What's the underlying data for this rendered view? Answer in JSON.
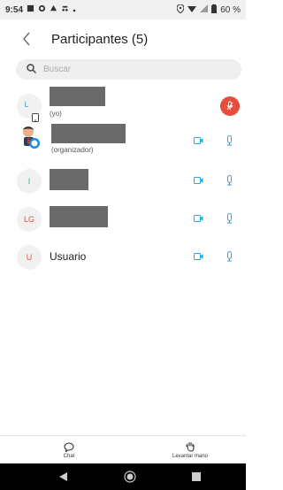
{
  "status_bar": {
    "time": "9:54",
    "battery": "60 %"
  },
  "header": {
    "title": "Participantes (5)",
    "back_icon": "chevron-left-icon"
  },
  "search": {
    "placeholder": "Buscar"
  },
  "participants": [
    {
      "initials": "L",
      "name": "[redacted]",
      "subtitle": "(yo)"
    },
    {
      "initials": "",
      "name": "[redacted]",
      "subtitle": "(organizador)"
    },
    {
      "initials": "I",
      "name": "[redacted]",
      "subtitle": ""
    },
    {
      "initials": "LG",
      "name": "[redacted]",
      "subtitle": ""
    },
    {
      "initials": "U",
      "name": "Usuario",
      "subtitle": ""
    }
  ],
  "colors": {
    "accent": "#29a8e0",
    "danger": "#e74c3c"
  },
  "bottom_tabs": [
    {
      "label": "Chat",
      "icon": "chat-bubble-icon"
    },
    {
      "label": "Levantar mano",
      "icon": "raise-hand-icon"
    }
  ],
  "nav_bar": {
    "buttons": [
      "back-triangle-icon",
      "home-circle-icon",
      "recents-square-icon"
    ]
  }
}
